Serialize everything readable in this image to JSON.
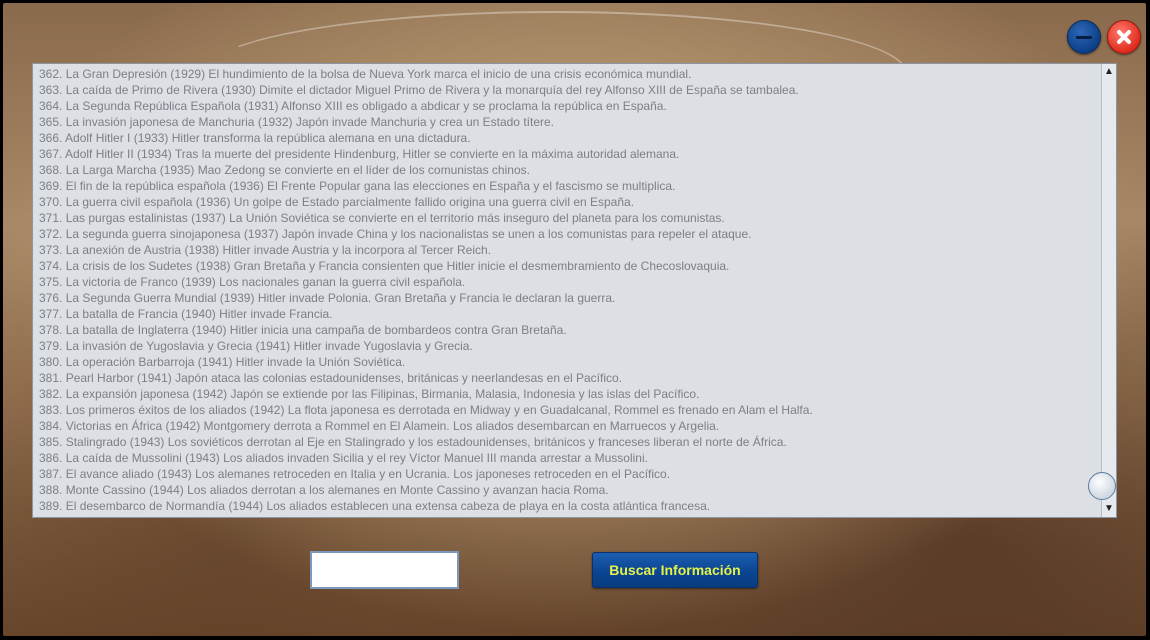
{
  "window": {
    "background": "#9a7654",
    "minimize_color": "#0c3f86",
    "close_color": "#e02c1f"
  },
  "list": {
    "items": [
      "362. La Gran Depresión (1929) El hundimiento de la bolsa de Nueva York marca el inicio de una crisis económica mundial.",
      "363. La caída de Primo de Rivera (1930) Dimite el dictador Miguel Primo de Rivera y la monarquía del rey Alfonso XIII de España se tambalea.",
      "364. La Segunda República Española (1931) Alfonso XIII es obligado a abdicar y se proclama la república en España.",
      "365. La invasión japonesa de Manchuria (1932) Japón invade Manchuria y crea un Estado títere.",
      "366. Adolf Hitler I (1933) Hitler transforma la república alemana en una dictadura.",
      "367. Adolf Hitler II (1934) Tras la muerte del presidente Hindenburg, Hitler se convierte en la máxima autoridad alemana.",
      "368. La Larga Marcha (1935) Mao Zedong se convierte en el líder de los comunistas chinos.",
      "369. El fin de la república española (1936) El Frente Popular gana las elecciones en España y el fascismo se multiplica.",
      "370. La guerra civil española (1936) Un golpe de Estado parcialmente fallido origina una guerra civil en España.",
      "371. Las purgas estalinistas (1937) La Unión Soviética se convierte en el territorio más inseguro del planeta para los comunistas.",
      "372. La segunda guerra sinojaponesa (1937) Japón invade China y los nacionalistas se unen a los comunistas para repeler el ataque.",
      "373. La anexión de Austria (1938) Hitler invade Austria y la incorpora al Tercer Reich.",
      "374. La crisis de los Sudetes (1938) Gran Bretaña y Francia consienten que Hitler inicie el desmembramiento de Checoslovaquia.",
      "375. La victoria de Franco (1939) Los nacionales ganan la guerra civil española.",
      "376. La Segunda Guerra Mundial (1939) Hitler invade Polonia. Gran Bretaña y Francia le declaran la guerra.",
      "377. La batalla de Francia (1940) Hitler invade Francia.",
      "378. La batalla de Inglaterra (1940) Hitler inicia una campaña de bombardeos contra Gran Bretaña.",
      "379. La invasión de Yugoslavia y Grecia (1941) Hitler invade Yugoslavia y Grecia.",
      "380. La operación Barbarroja (1941) Hitler invade la Unión Soviética.",
      "381. Pearl Harbor (1941) Japón ataca las colonias estadounidenses, británicas y neerlandesas en el Pacífico.",
      "382. La expansión japonesa (1942) Japón se extiende por las Filipinas, Birmania, Malasia, Indonesia y las islas del Pacífico.",
      "383. Los primeros éxitos de los aliados (1942) La flota japonesa es derrotada en Midway y en Guadalcanal, Rommel es frenado en Alam el Halfa.",
      "384. Victorias en África (1942) Montgomery derrota a Rommel en El Alamein. Los aliados desembarcan en Marruecos y Argelia.",
      "385. Stalingrado (1943) Los soviéticos derrotan al Eje en Stalingrado y los estadounidenses, británicos y franceses liberan el norte de África.",
      "386. La caída de Mussolini (1943) Los aliados invaden Sicilia y el rey Víctor Manuel III manda arrestar a Mussolini.",
      "387. El avance aliado (1943) Los alemanes retroceden en Italia y en Ucrania. Los japoneses retroceden en el Pacífico.",
      "388. Monte Cassino (1944) Los aliados derrotan a los alemanes en Monte Cassino y avanzan hacia Roma.",
      "389. El desembarco de Normandía (1944) Los aliados establecen una extensa cabeza de playa en la costa atlántica francesa."
    ],
    "scroll_up_glyph": "▲",
    "scroll_down_glyph": "▼"
  },
  "search": {
    "value": "",
    "button_label": "Buscar Información",
    "button_color": "#0b4592",
    "button_text_color": "#e6f24a"
  },
  "icons": {
    "minimize": "minimize-icon",
    "close": "close-icon"
  }
}
